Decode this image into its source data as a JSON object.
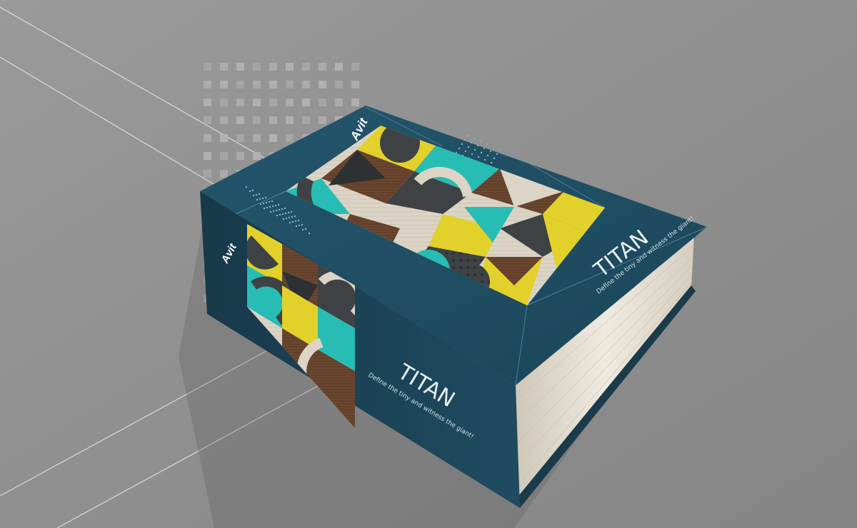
{
  "book": {
    "brand": "Avit",
    "title": "TITAN",
    "tagline": "Define the tiny and witness the giant!"
  },
  "colors": {
    "background": "#8f8f8f",
    "cover": "#1f4d63",
    "cover_dark": "#16394b",
    "teal": "#27bdb4",
    "yellow": "#e3d12b",
    "wood_dark": "#6b4730",
    "wood_light": "#d9d2c3",
    "charcoal": "#3f4244",
    "pages": "#e9e4d9"
  }
}
